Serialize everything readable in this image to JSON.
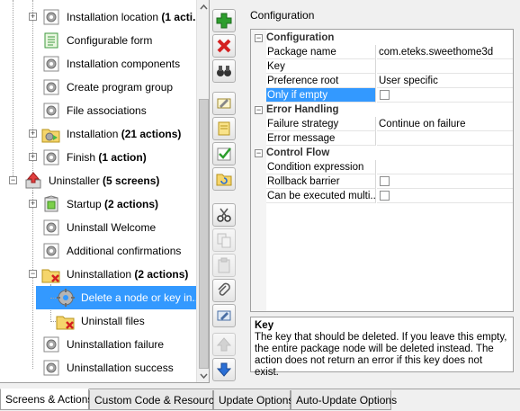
{
  "tree": {
    "items": [
      {
        "name": "Installation location",
        "suffix": " (1 acti...",
        "icon": "gear-icon"
      },
      {
        "name": "Configurable form",
        "suffix": "",
        "icon": "form-icon"
      },
      {
        "name": "Installation components",
        "suffix": "",
        "icon": "gear-icon"
      },
      {
        "name": "Create program group",
        "suffix": "",
        "icon": "gear-icon"
      },
      {
        "name": "File associations",
        "suffix": "",
        "icon": "gear-icon"
      },
      {
        "name": "Installation",
        "suffix": " (21 actions)",
        "icon": "folder-gear-icon"
      },
      {
        "name": "Finish",
        "suffix": " (1 action)",
        "icon": "gear-icon"
      },
      {
        "name": "Uninstaller",
        "suffix": " (5 screens)",
        "icon": "uninstaller-icon"
      },
      {
        "name": "Startup",
        "suffix": " (2 actions)",
        "icon": "startup-icon"
      },
      {
        "name": "Uninstall Welcome",
        "suffix": "",
        "icon": "gear-icon"
      },
      {
        "name": "Additional confirmations",
        "suffix": "",
        "icon": "gear-icon"
      },
      {
        "name": "Uninstallation",
        "suffix": " (2 actions)",
        "icon": "folder-delete-icon"
      },
      {
        "name": "Delete a node or key in...",
        "suffix": "",
        "icon": "gear-icon"
      },
      {
        "name": "Uninstall files",
        "suffix": "",
        "icon": "folder-delete-icon"
      },
      {
        "name": "Uninstallation failure",
        "suffix": "",
        "icon": "gear-icon"
      },
      {
        "name": "Uninstallation success",
        "suffix": "",
        "icon": "gear-icon"
      }
    ]
  },
  "toolbar": {
    "buttons": [
      {
        "name": "add-button",
        "icon": "plus-icon"
      },
      {
        "name": "delete-button",
        "icon": "x-icon"
      },
      {
        "name": "find-button",
        "icon": "binoculars-icon"
      },
      {
        "name": "rename-button",
        "icon": "rename-icon"
      },
      {
        "name": "comment-button",
        "icon": "note-icon"
      },
      {
        "name": "check-button",
        "icon": "check-icon"
      },
      {
        "name": "reload-button",
        "icon": "folder-refresh-icon"
      },
      {
        "name": "cut-button",
        "icon": "scissors-icon"
      },
      {
        "name": "copy-button",
        "icon": "copy-icon"
      },
      {
        "name": "paste-button",
        "icon": "paste-icon"
      },
      {
        "name": "link-button",
        "icon": "paperclip-icon"
      },
      {
        "name": "edit-button",
        "icon": "edit-icon"
      },
      {
        "name": "move-up-button",
        "icon": "arrow-up-icon"
      },
      {
        "name": "move-down-button",
        "icon": "arrow-down-icon"
      }
    ]
  },
  "config": {
    "title": "Configuration",
    "categories": {
      "configuration": "Configuration",
      "error_handling": "Error Handling",
      "control_flow": "Control Flow"
    },
    "properties": {
      "package_name": {
        "label": "Package name",
        "value": "com.eteks.sweethome3d"
      },
      "key": {
        "label": "Key",
        "value": ""
      },
      "preference_root": {
        "label": "Preference root",
        "value": "User specific"
      },
      "only_if_empty": {
        "label": "Only if empty",
        "checked": false
      },
      "failure_strategy": {
        "label": "Failure strategy",
        "value": "Continue on failure"
      },
      "error_message": {
        "label": "Error message",
        "value": ""
      },
      "condition_expression": {
        "label": "Condition expression",
        "value": ""
      },
      "rollback_barrier": {
        "label": "Rollback barrier",
        "checked": false
      },
      "can_be_executed": {
        "label": "Can be executed multi...",
        "checked": false
      }
    },
    "description": {
      "title": "Key",
      "text": "The key that should be deleted. If you leave this empty, the entire package node will be deleted instead. The action does not return an error if this key does not exist."
    }
  },
  "tabs": [
    {
      "label": "Screens & Actions",
      "active": true
    },
    {
      "label": "Custom Code & Resources",
      "active": false
    },
    {
      "label": "Update Options",
      "active": false
    },
    {
      "label": "Auto-Update Options",
      "active": false
    }
  ],
  "colors": {
    "selection": "#3399ff",
    "add_green": "#2e9e2e",
    "delete_red": "#d42020",
    "arrow_blue": "#2a6fd6"
  }
}
